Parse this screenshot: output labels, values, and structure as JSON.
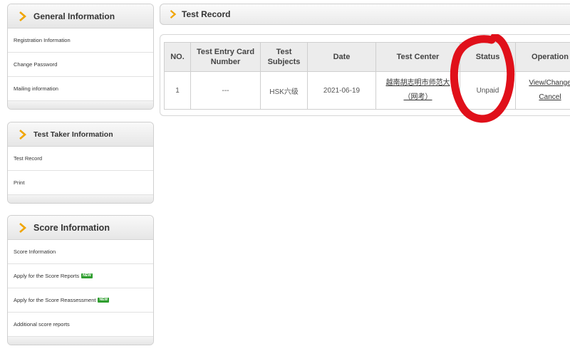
{
  "sidebar": {
    "general": {
      "title": "General Information",
      "items": [
        "Registration Information",
        "Change Password",
        "Mailing information"
      ]
    },
    "test_taker": {
      "title": "Test Taker Information",
      "items": [
        "Test Record",
        "Print"
      ]
    },
    "score": {
      "title": "Score Information",
      "items": [
        "Score Information",
        "Apply for the Score Reports",
        "Apply for the Score Reassessment",
        "Additional score reports"
      ],
      "new_badge": "NEW"
    }
  },
  "main": {
    "title": "Test Record",
    "table": {
      "headers": [
        "NO.",
        "Test Entry Card Number",
        "Test Subjects",
        "Date",
        "Test Center",
        "Status",
        "Operation"
      ],
      "row": {
        "no": "1",
        "card_number": "---",
        "subject": "HSK六级",
        "date": "2021-06-19",
        "center_line1": "越南胡志明市师范大",
        "center_line2": "（网考）",
        "status": "Unpaid",
        "op_view_change": "View/Change",
        "op_cancel": "Cancel"
      }
    }
  },
  "colors": {
    "accent_chevron": "#f0a500",
    "new_badge": "#2f9e2f",
    "annotation_circle": "#e0101a"
  },
  "icons": {
    "chevron": "chevron-right-icon"
  }
}
